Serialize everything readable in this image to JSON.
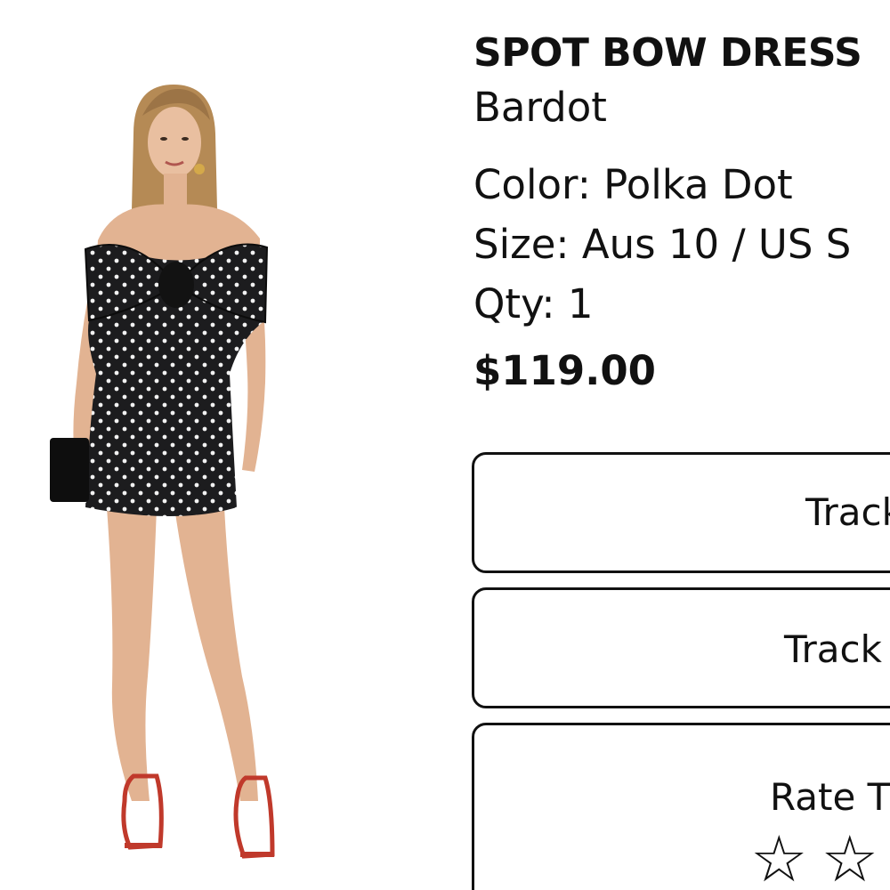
{
  "product": {
    "title": "SPOT BOW DRESS",
    "brand": "Bardot",
    "color_text": "Color: Polka Dot",
    "size_text": "Size: Aus 10 / US S",
    "qty_text": "Qty: 1",
    "price": "$119.00"
  },
  "actions": {
    "track_1_label": "Track",
    "track_2_label": "Track"
  },
  "rating": {
    "label": "Rate Th",
    "stars": [
      "☆",
      "☆",
      "☆"
    ],
    "star_icon": "star-outline-icon"
  },
  "colors": {
    "text": "#111111",
    "background": "#ffffff",
    "dress": "#1c1c1e",
    "dots": "#f2f2f2",
    "shoes": "#c0392b"
  }
}
